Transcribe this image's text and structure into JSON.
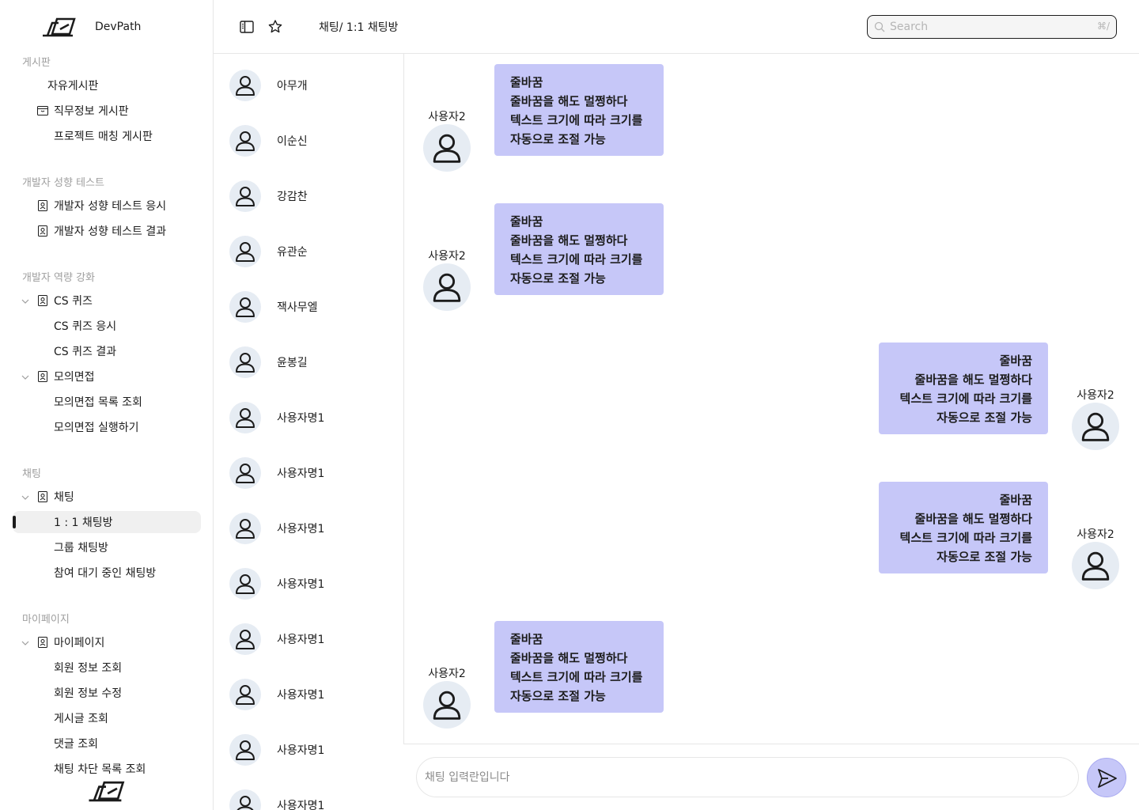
{
  "app": {
    "name": "DevPath"
  },
  "sidebar": {
    "sections": [
      {
        "title": "게시판",
        "items": [
          {
            "label": "자유게시판"
          },
          {
            "label": "직무정보 게시판"
          },
          {
            "label": "프로젝트 매칭 게시판"
          }
        ]
      },
      {
        "title": "개발자 성향 테스트",
        "items": [
          {
            "label": "개발자 성향 테스트 응시"
          },
          {
            "label": "개발자 성향 테스트 결과"
          }
        ]
      },
      {
        "title": "개발자 역량 강화",
        "items": [
          {
            "label": "CS 퀴즈"
          },
          {
            "label": "CS 퀴즈 응시"
          },
          {
            "label": "CS 퀴즈 결과"
          },
          {
            "label": "모의면접"
          },
          {
            "label": "모의면접 목록 조회"
          },
          {
            "label": "모의면접 실행하기"
          }
        ]
      },
      {
        "title": "채팅",
        "items": [
          {
            "label": "채팅"
          },
          {
            "label": "1 : 1 채팅방"
          },
          {
            "label": "그룹 채팅방"
          },
          {
            "label": "참여 대기 중인 채팅방"
          }
        ]
      },
      {
        "title": "마이페이지",
        "items": [
          {
            "label": "마이페이지"
          },
          {
            "label": "회원 정보 조회"
          },
          {
            "label": "회원 정보 수정"
          },
          {
            "label": "게시글 조회"
          },
          {
            "label": "댓글 조회"
          },
          {
            "label": "채팅 차단 목록 조회"
          }
        ]
      }
    ]
  },
  "header": {
    "breadcrumb": "채팅/ 1:1 채팅방",
    "search_placeholder": "Search",
    "search_shortcut": "⌘/"
  },
  "chat_list": [
    {
      "name": "아무개"
    },
    {
      "name": "이순신"
    },
    {
      "name": "강감찬"
    },
    {
      "name": "유관순"
    },
    {
      "name": "잭사무엘"
    },
    {
      "name": "윤봉길"
    },
    {
      "name": "사용자명1"
    },
    {
      "name": "사용자명1"
    },
    {
      "name": "사용자명1"
    },
    {
      "name": "사용자명1"
    },
    {
      "name": "사용자명1"
    },
    {
      "name": "사용자명1"
    },
    {
      "name": "사용자명1"
    },
    {
      "name": "사용자명1"
    }
  ],
  "messages": [
    {
      "sender": "사용자2",
      "side": "left",
      "text": "줄바꿈\n줄바꿈을 해도 멀쩡하다\n텍스트 크기에 따라 크기를\n자동으로 조절 가능"
    },
    {
      "sender": "사용자2",
      "side": "left",
      "text": "줄바꿈\n줄바꿈을 해도 멀쩡하다\n텍스트 크기에 따라 크기를\n자동으로 조절 가능"
    },
    {
      "sender": "사용자2",
      "side": "right",
      "text": "줄바꿈\n줄바꿈을 해도 멀쩡하다\n텍스트 크기에 따라 크기를\n자동으로 조절 가능"
    },
    {
      "sender": "사용자2",
      "side": "right",
      "text": "줄바꿈\n줄바꿈을 해도 멀쩡하다\n텍스트 크기에 따라 크기를\n자동으로 조절 가능"
    },
    {
      "sender": "사용자2",
      "side": "left",
      "text": "줄바꿈\n줄바꿈을 해도 멀쩡하다\n텍스트 크기에 따라 크기를\n자동으로 조절 가능"
    }
  ],
  "composer": {
    "placeholder": "채팅 입력란입니다",
    "value": ""
  },
  "colors": {
    "bubble": "#c6c7f8",
    "avatar_bg": "#e6ecf3",
    "active_item_bg": "#f0f0f0",
    "text": "#1c1c1c",
    "muted": "#9e9e9e"
  }
}
